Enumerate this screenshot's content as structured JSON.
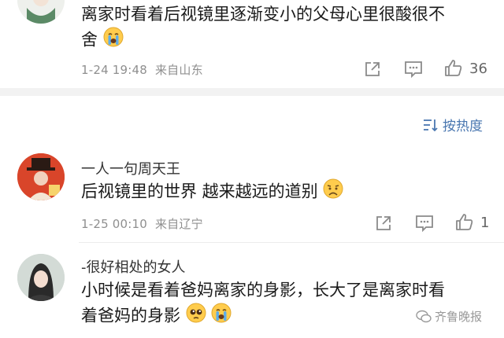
{
  "comments": [
    {
      "text_line1": "离家时看着后视镜里逐渐变小的父母心里很酸很不",
      "text_line2": "舍",
      "emoji": "crying-face",
      "time": "1-24 19:48",
      "location": "来自山东",
      "likes": "36"
    },
    {
      "author": "一人一句周天王",
      "text": "后视镜里的世界 越来越远的道别",
      "emoji": "sad-face",
      "time": "1-25 00:10",
      "location": "来自辽宁",
      "likes": "1"
    },
    {
      "author": "-很好相处的女人",
      "text_line1": "小时候是看着爸妈离家的身影，长大了是离家时看",
      "text_line2": "着爸妈的身影",
      "emoji1": "pleading-face",
      "emoji2": "crying-face"
    }
  ],
  "sort": {
    "label": "按热度"
  },
  "watermark": {
    "text": "齐鲁晚报"
  },
  "colors": {
    "accent": "#4a77b0",
    "divider": "#f2f2f2",
    "meta": "#8f8f8f"
  }
}
